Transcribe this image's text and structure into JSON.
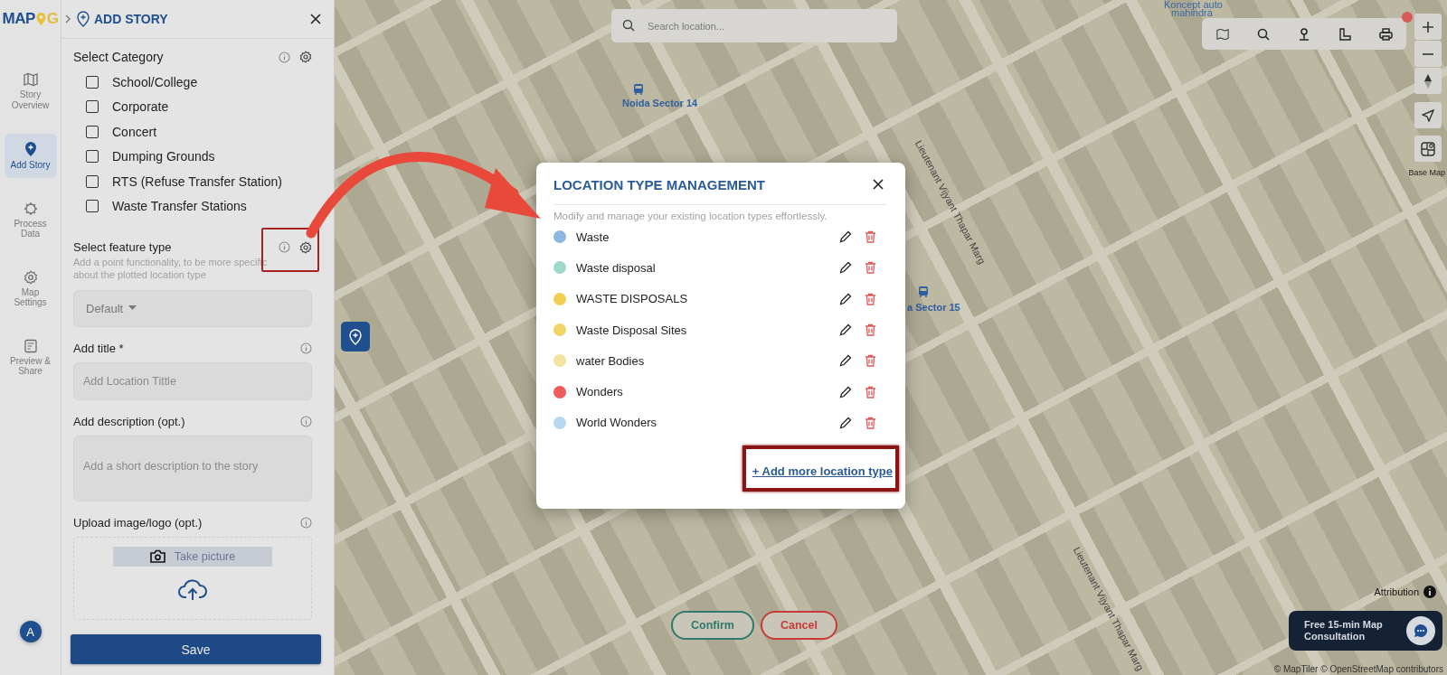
{
  "logo": {
    "left": "MAP",
    "right": "G"
  },
  "panel": {
    "title": "ADD STORY"
  },
  "rail": [
    {
      "kind": "map",
      "label": "Story Overview",
      "selected": false
    },
    {
      "kind": "pin",
      "label": "Add Story",
      "selected": true
    },
    {
      "kind": "process",
      "label": "Process Data",
      "selected": false
    },
    {
      "kind": "gear",
      "label": "Map Settings",
      "selected": false
    },
    {
      "kind": "preview",
      "label": "Preview & Share",
      "selected": false
    }
  ],
  "avatar": "A",
  "category": {
    "title": "Select Category",
    "items": [
      {
        "label": "School/College",
        "checked": false
      },
      {
        "label": "Corporate",
        "checked": false
      },
      {
        "label": "Concert",
        "checked": false
      },
      {
        "label": "Dumping Grounds",
        "checked": false
      },
      {
        "label": "RTS (Refuse Transfer Station)",
        "checked": false
      },
      {
        "label": "Waste Transfer Stations",
        "checked": false
      }
    ]
  },
  "feature_type": {
    "title": "Select feature type",
    "description": "Add a point functionality, to be more specific about the plotted location type",
    "value": "Default"
  },
  "title_field": {
    "label": "Add title *",
    "placeholder": "Add Location Tittle"
  },
  "description_field": {
    "label": "Add description (opt.)",
    "placeholder": "Add a short description to the story"
  },
  "upload": {
    "label": "Upload image/logo (opt.)",
    "take_picture": "Take picture"
  },
  "save": "Save",
  "map": {
    "search": {
      "placeholder": "Search location..."
    },
    "labels": [
      {
        "text": "Noida Sector 14",
        "kind": "transit"
      },
      {
        "text": "Koncept auto",
        "kind": "poi"
      },
      {
        "text": "mahindra",
        "kind": "poi"
      },
      {
        "text": "a Sector 15",
        "kind": "transit"
      },
      {
        "text": "Lieutenant Vijyant Thapar Marg",
        "kind": "road"
      },
      {
        "text": "Lieutenant Vijyant Thapar Marg",
        "kind": "road"
      }
    ],
    "base_map": "Base Map",
    "attribution": "Attribution",
    "copyright": "© MapTiler © OpenStreetMap contributors",
    "consultation": "Free 15-min Map Consultation",
    "confirm": "Confirm",
    "cancel": "Cancel"
  },
  "modal": {
    "title": "LOCATION TYPE MANAGEMENT",
    "subtitle": "Modify and manage your existing location types effortlessly.",
    "items": [
      {
        "label": "Waste",
        "color": "#8fb8e0"
      },
      {
        "label": "Waste disposal",
        "color": "#9fd9cb"
      },
      {
        "label": "WASTE DISPOSALS",
        "color": "#f2cf55"
      },
      {
        "label": "Waste Disposal Sites",
        "color": "#f2d468"
      },
      {
        "label": "water Bodies",
        "color": "#f3e39f"
      },
      {
        "label": "Wonders",
        "color": "#ee5b5b"
      },
      {
        "label": "World Wonders",
        "color": "#b8d6ef"
      }
    ],
    "add_link": "+ Add more location type"
  }
}
